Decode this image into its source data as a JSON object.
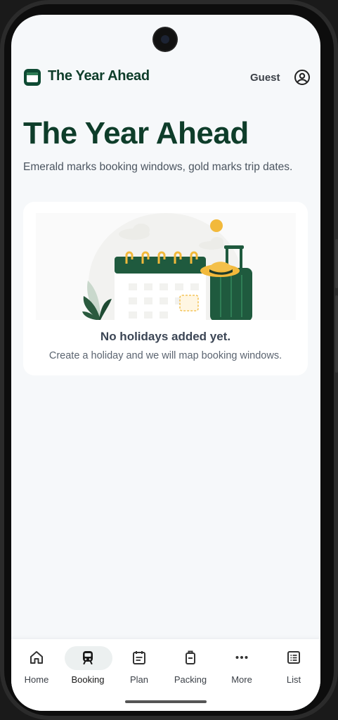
{
  "header": {
    "app_title": "The Year Ahead",
    "user_label": "Guest"
  },
  "hero": {
    "title": "The Year Ahead",
    "subtitle": "Emerald marks booking windows, gold marks trip dates."
  },
  "empty_state": {
    "title": "No holidays added yet.",
    "subtitle": "Create a holiday and we will map booking windows."
  },
  "bottom_nav": {
    "items": [
      {
        "label": "Home",
        "icon": "home-icon",
        "active": false
      },
      {
        "label": "Booking",
        "icon": "train-icon",
        "active": true
      },
      {
        "label": "Plan",
        "icon": "calendar-icon",
        "active": false
      },
      {
        "label": "Packing",
        "icon": "luggage-icon",
        "active": false
      },
      {
        "label": "More",
        "icon": "more-icon",
        "active": false
      },
      {
        "label": "List",
        "icon": "list-icon",
        "active": false
      }
    ]
  },
  "colors": {
    "emerald": "#0e4a33",
    "gold": "#f2b93b",
    "background": "#f6f8fa"
  }
}
